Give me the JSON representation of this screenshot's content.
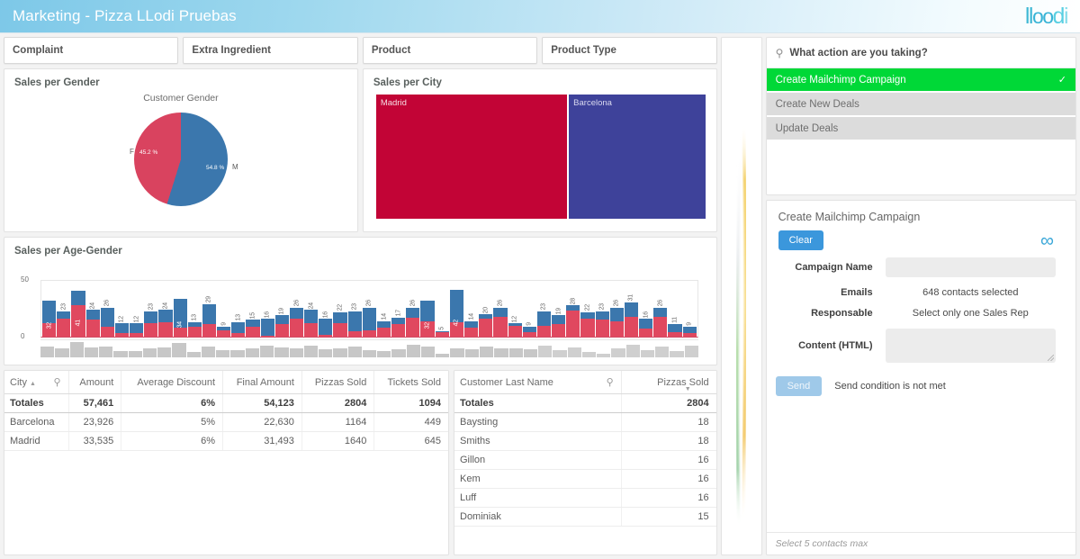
{
  "header": {
    "title": "Marketing - Pizza LLodi Pruebas",
    "logo": {
      "part1": "ll",
      "part2": "oo",
      "part3": "d",
      "part4": "i"
    }
  },
  "filters": [
    {
      "label": "Complaint"
    },
    {
      "label": "Extra Ingredient"
    },
    {
      "label": "Product"
    },
    {
      "label": "Product Type"
    }
  ],
  "cards": {
    "gender_title": "Sales per Gender",
    "city_title": "Sales per City",
    "age_gender_title": "Sales per Age-Gender"
  },
  "chart_data": [
    {
      "type": "pie",
      "title": "Customer Gender",
      "categories": [
        "M",
        "F"
      ],
      "values": [
        54.8,
        45.2
      ],
      "labels": [
        "54.8 %",
        "45.2 %"
      ],
      "colors": [
        "#3b77ad",
        "#d9435f"
      ],
      "legend": "outside-labels"
    },
    {
      "type": "treemap",
      "title": "Sales per City",
      "categories": [
        "Madrid",
        "Barcelona"
      ],
      "values": [
        33535,
        23926
      ],
      "colors": [
        "#c20436",
        "#3e429a"
      ]
    },
    {
      "type": "bar",
      "title": "Sales per Age-Gender",
      "stacked": true,
      "ylim": [
        0,
        50
      ],
      "yticks": [
        "0",
        "50"
      ],
      "xlabel": "",
      "ylabel": "",
      "series": [
        {
          "name": "F",
          "color": "#e0485f"
        },
        {
          "name": "M",
          "color": "#3b77ad"
        }
      ],
      "bars": [
        {
          "total": 32,
          "f": 12,
          "m": 20,
          "label": "32",
          "inside": true
        },
        {
          "total": 23,
          "f": 16,
          "m": 7,
          "label": "23",
          "inside": false
        },
        {
          "total": 41,
          "f": 28,
          "m": 13,
          "label": "41",
          "inside": true
        },
        {
          "total": 24,
          "f": 15,
          "m": 9,
          "label": "24",
          "inside": false
        },
        {
          "total": 26,
          "f": 9,
          "m": 17,
          "label": "26",
          "inside": false
        },
        {
          "total": 12,
          "f": 3,
          "m": 9,
          "label": "12",
          "inside": false
        },
        {
          "total": 12,
          "f": 3,
          "m": 9,
          "label": "12",
          "inside": false
        },
        {
          "total": 23,
          "f": 12,
          "m": 11,
          "label": "23",
          "inside": false
        },
        {
          "total": 24,
          "f": 13,
          "m": 11,
          "label": "24",
          "inside": false
        },
        {
          "total": 34,
          "f": 8,
          "m": 26,
          "label": "34",
          "inside": true
        },
        {
          "total": 13,
          "f": 9,
          "m": 4,
          "label": "13",
          "inside": false
        },
        {
          "total": 29,
          "f": 11,
          "m": 18,
          "label": "29",
          "inside": false
        },
        {
          "total": 9,
          "f": 6,
          "m": 3,
          "label": "9",
          "inside": false
        },
        {
          "total": 13,
          "f": 3,
          "m": 10,
          "label": "13",
          "inside": false
        },
        {
          "total": 15,
          "f": 9,
          "m": 6,
          "label": "15",
          "inside": false
        },
        {
          "total": 16,
          "f": 1,
          "m": 15,
          "label": "16",
          "inside": false
        },
        {
          "total": 19,
          "f": 11,
          "m": 8,
          "label": "19",
          "inside": false
        },
        {
          "total": 26,
          "f": 16,
          "m": 10,
          "label": "26",
          "inside": false
        },
        {
          "total": 24,
          "f": 12,
          "m": 12,
          "label": "24",
          "inside": false
        },
        {
          "total": 16,
          "f": 2,
          "m": 14,
          "label": "16",
          "inside": false
        },
        {
          "total": 22,
          "f": 12,
          "m": 10,
          "label": "22",
          "inside": false
        },
        {
          "total": 23,
          "f": 5,
          "m": 18,
          "label": "23",
          "inside": false
        },
        {
          "total": 26,
          "f": 6,
          "m": 20,
          "label": "26",
          "inside": false
        },
        {
          "total": 14,
          "f": 8,
          "m": 6,
          "label": "14",
          "inside": false
        },
        {
          "total": 17,
          "f": 11,
          "m": 6,
          "label": "17",
          "inside": false
        },
        {
          "total": 26,
          "f": 17,
          "m": 9,
          "label": "26",
          "inside": false
        },
        {
          "total": 32,
          "f": 14,
          "m": 18,
          "label": "32",
          "inside": true
        },
        {
          "total": 5,
          "f": 4,
          "m": 1,
          "label": "5",
          "inside": false
        },
        {
          "total": 42,
          "f": 13,
          "m": 29,
          "label": "42",
          "inside": true
        },
        {
          "total": 14,
          "f": 8,
          "m": 6,
          "label": "14",
          "inside": false
        },
        {
          "total": 20,
          "f": 16,
          "m": 4,
          "label": "20",
          "inside": false
        },
        {
          "total": 26,
          "f": 18,
          "m": 8,
          "label": "26",
          "inside": false
        },
        {
          "total": 12,
          "f": 10,
          "m": 2,
          "label": "12",
          "inside": false
        },
        {
          "total": 9,
          "f": 4,
          "m": 5,
          "label": "9",
          "inside": false
        },
        {
          "total": 23,
          "f": 10,
          "m": 13,
          "label": "23",
          "inside": false
        },
        {
          "total": 19,
          "f": 11,
          "m": 8,
          "label": "19",
          "inside": false
        },
        {
          "total": 28,
          "f": 23,
          "m": 5,
          "label": "28",
          "inside": false
        },
        {
          "total": 22,
          "f": 16,
          "m": 6,
          "label": "22",
          "inside": false
        },
        {
          "total": 23,
          "f": 15,
          "m": 8,
          "label": "23",
          "inside": false
        },
        {
          "total": 26,
          "f": 14,
          "m": 12,
          "label": "26",
          "inside": false
        },
        {
          "total": 31,
          "f": 18,
          "m": 13,
          "label": "31",
          "inside": false
        },
        {
          "total": 16,
          "f": 7,
          "m": 9,
          "label": "16",
          "inside": false
        },
        {
          "total": 26,
          "f": 18,
          "m": 8,
          "label": "26",
          "inside": false
        },
        {
          "total": 11,
          "f": 4,
          "m": 7,
          "label": "11",
          "inside": false
        },
        {
          "total": 9,
          "f": 3,
          "m": 6,
          "label": "9",
          "inside": false
        }
      ],
      "minimap": [
        11,
        9,
        15,
        10,
        11,
        6,
        6,
        9,
        10,
        14,
        5,
        11,
        7,
        7,
        9,
        12,
        10,
        9,
        12,
        8,
        9,
        11,
        7,
        6,
        8,
        13,
        11,
        4,
        9,
        8,
        11,
        9,
        9,
        8,
        12,
        7,
        10,
        5,
        4,
        9,
        13,
        7,
        11,
        6,
        12
      ]
    }
  ],
  "city_table": {
    "columns": [
      "City",
      "Amount",
      "Average Discount",
      "Final Amount",
      "Pizzas Sold",
      "Tickets Sold"
    ],
    "totals_label": "Totales",
    "totals": [
      "57,461",
      "6%",
      "54,123",
      "2804",
      "1094"
    ],
    "rows": [
      {
        "city": "Barcelona",
        "amount": "23,926",
        "discount": "5%",
        "final": "22,630",
        "pizzas": "1164",
        "tickets": "449"
      },
      {
        "city": "Madrid",
        "amount": "33,535",
        "discount": "6%",
        "final": "31,493",
        "pizzas": "1640",
        "tickets": "645"
      }
    ]
  },
  "customer_table": {
    "columns": [
      "Customer Last Name",
      "Pizzas Sold"
    ],
    "totals_label": "Totales",
    "totals_value": "2804",
    "rows": [
      {
        "name": "Baysting",
        "pizzas": "18"
      },
      {
        "name": "Smiths",
        "pizzas": "18"
      },
      {
        "name": "Gillon",
        "pizzas": "16"
      },
      {
        "name": "Kem",
        "pizzas": "16"
      },
      {
        "name": "Luff",
        "pizzas": "16"
      },
      {
        "name": "Dominiak",
        "pizzas": "15"
      }
    ]
  },
  "action_panel": {
    "search_label": "What action are you taking?",
    "options": [
      {
        "label": "Create Mailchimp Campaign",
        "selected": true
      },
      {
        "label": "Create New Deals",
        "selected": false
      },
      {
        "label": "Update Deals",
        "selected": false
      }
    ]
  },
  "campaign": {
    "title": "Create Mailchimp Campaign",
    "clear_label": "Clear",
    "fields": {
      "campaign_name_label": "Campaign Name",
      "campaign_name_value": "",
      "emails_label": "Emails",
      "emails_value": "648 contacts selected",
      "responsable_label": "Responsable",
      "responsable_value": "Select only one Sales Rep",
      "content_label": "Content (HTML)",
      "content_value": ""
    },
    "send_label": "Send",
    "send_message": "Send condition is not met",
    "footer_note": "Select 5 contacts max"
  },
  "colors": {
    "accent_green": "#00d837",
    "accent_blue": "#3b97dc",
    "bar_blue": "#3b77ad",
    "bar_red": "#e0485f",
    "madrid": "#c20436",
    "barcelona": "#3e429a",
    "header_blue": "#7dc8e8"
  }
}
